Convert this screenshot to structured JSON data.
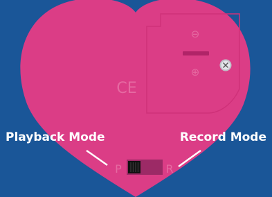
{
  "labels": {
    "playback_mode": "Playback Mode",
    "record_mode": "Record Mode"
  },
  "device": {
    "ce_mark": "CE",
    "minus_symbol": "⊖",
    "plus_symbol": "⊕",
    "switch_left_letter": "P",
    "switch_right_letter": "R",
    "switch_position": "P"
  },
  "colors": {
    "background": "#1a5698",
    "heart": "#db3d86",
    "embossed": "#e66aa2",
    "battery_bar": "#b02468",
    "switch_track": "#9c2a66",
    "switch_knob": "#111111",
    "label_text": "#ffffff"
  },
  "icons": {
    "screw": "screw-icon",
    "minus": "minus-icon",
    "plus": "plus-icon"
  }
}
